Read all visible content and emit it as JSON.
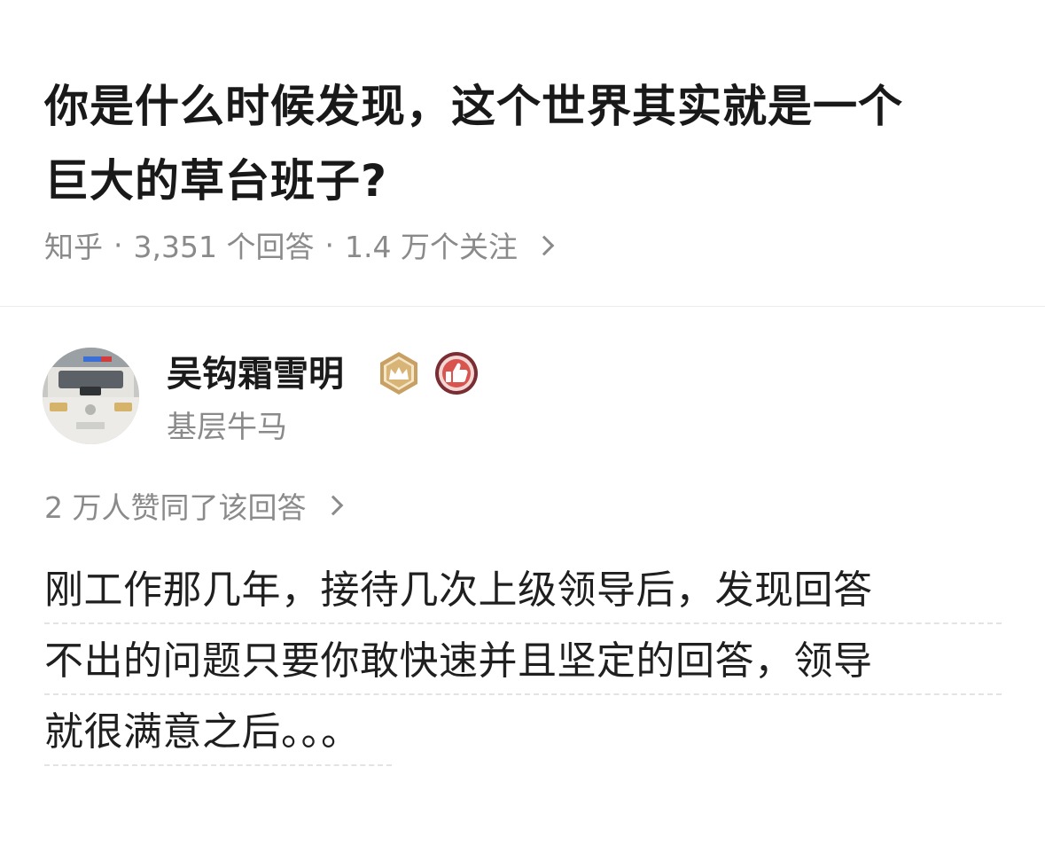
{
  "question": {
    "title_line1": "你是什么时候发现，这个世界其实就是一个",
    "title_line2": "巨大的草台班子?",
    "source": "知乎",
    "separator": "·",
    "answer_count": "3,351 个回答",
    "follower_count": "1.4 万个关注"
  },
  "author": {
    "name": "吴钩霜雪明",
    "bio": "基层牛马",
    "badges": [
      "crown-badge-icon",
      "thumbs-up-badge-icon"
    ]
  },
  "answer": {
    "upvote_summary": "2 万人赞同了该回答",
    "lines": [
      "刚工作那几年，接待几次上级领导后，发现回答",
      "不出的问题只要你敢快速并且坚定的回答，领导",
      "就很满意之后。。。"
    ]
  },
  "colors": {
    "title": "#191919",
    "meta": "#8a8a8a",
    "body": "#1f1f1f",
    "badge_gold": "#c9a063",
    "badge_red": "#d9534f"
  }
}
